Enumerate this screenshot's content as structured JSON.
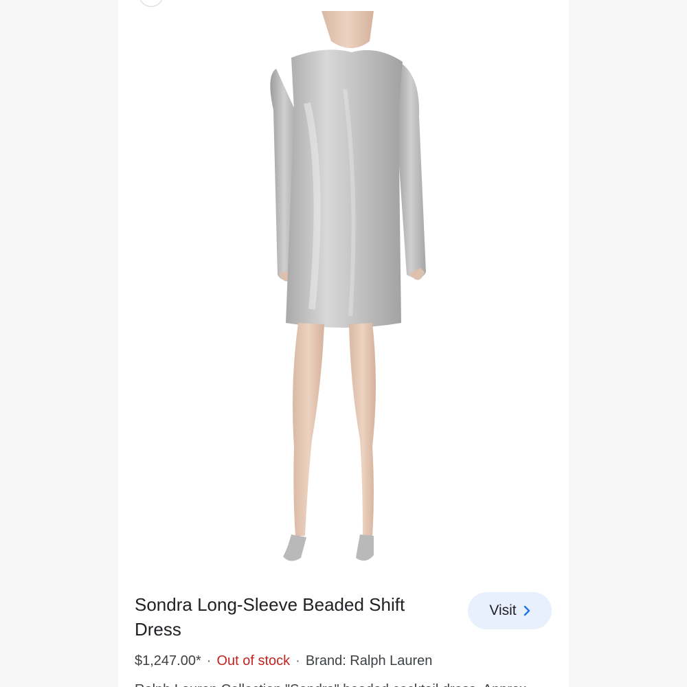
{
  "product": {
    "title": "Sondra Long-Sleeve Beaded Shift Dress",
    "price": "$1,247.00*",
    "separator": "·",
    "stock_status": "Out of stock",
    "brand_label": "Brand: Ralph Lauren",
    "description": "Ralph Lauren Collection \"Sondra\" beaded cocktail dress. Approx",
    "image_alt": "product-photo-silver-sequin-dress"
  },
  "actions": {
    "visit_label": "Visit",
    "visit_icon": "chevron-right-icon"
  },
  "colors": {
    "accent_button_bg": "#e8f0fe",
    "stock_red": "#c5221f",
    "text_primary": "#202124"
  }
}
